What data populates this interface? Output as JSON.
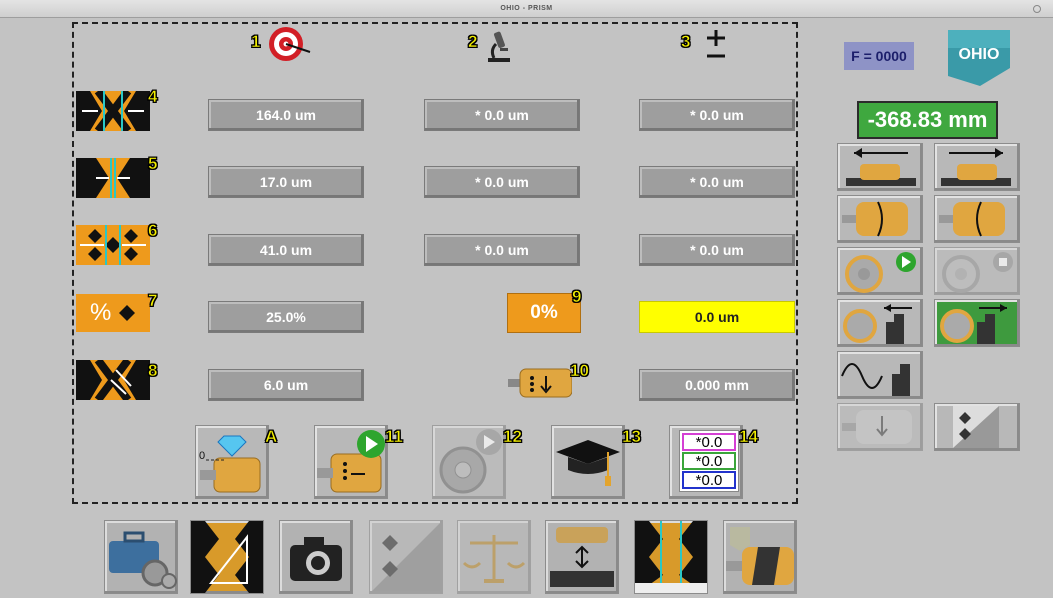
{
  "window": {
    "title": "OHIO - PRISM"
  },
  "columns": [
    {
      "number": "1",
      "icon": "target-icon"
    },
    {
      "number": "2",
      "icon": "microscope-icon"
    },
    {
      "number": "3",
      "icon": "plus-minus-icon"
    }
  ],
  "rows": [
    {
      "number": "4",
      "icon": "pattern-width-icon",
      "target": "164.0 um",
      "measured": "* 0.0 um",
      "delta": "* 0.0 um"
    },
    {
      "number": "5",
      "icon": "pattern-wall-icon",
      "target": "17.0 um",
      "measured": "* 0.0 um",
      "delta": "* 0.0 um"
    },
    {
      "number": "6",
      "icon": "pattern-opening-icon",
      "target": "41.0 um",
      "measured": "* 0.0 um",
      "delta": "* 0.0 um"
    },
    {
      "number": "7",
      "icon": "percent-icon",
      "icon_text": "%",
      "target": "25.0%",
      "percent_number": "9",
      "percent_value": "0%",
      "delta": "0.0 um"
    },
    {
      "number": "8",
      "icon": "pattern-depth-icon",
      "target": "6.0 um",
      "roller_number": "10",
      "delta": "0.000 mm"
    }
  ],
  "actions": [
    {
      "number": "A",
      "icon": "diamond-tool-icon",
      "icon_text": "0"
    },
    {
      "number": "11",
      "icon": "play-engrave-icon"
    },
    {
      "number": "12",
      "icon": "play-disc-icon"
    },
    {
      "number": "13",
      "icon": "graduation-cap-icon"
    },
    {
      "number": "14",
      "icon": "values-list-icon",
      "values": [
        "*0.0",
        "*0.0",
        "*0.0"
      ]
    }
  ],
  "right_panel": {
    "f_label": "F = 0000",
    "logo_text": "OHIO",
    "position": "-368.83 mm"
  },
  "colors": {
    "accent": "#ee9a1c",
    "readout": "#3fa83f",
    "highlight": "#ffff00",
    "label": "#f4f000"
  }
}
